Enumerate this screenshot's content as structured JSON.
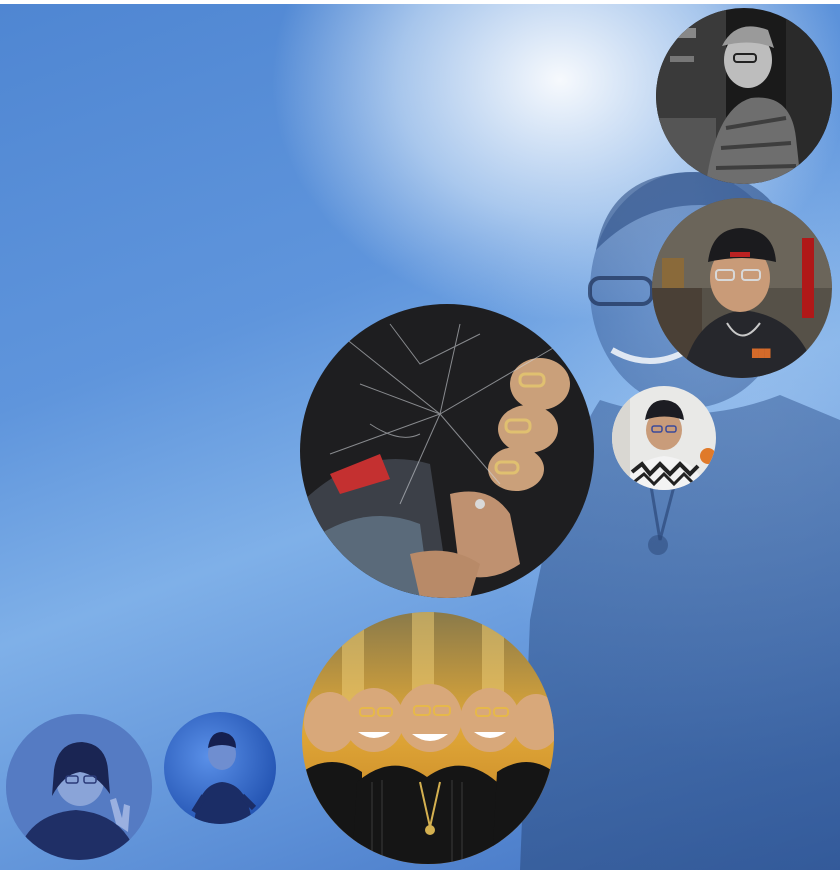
{
  "scene": {
    "background_color": "#5b8fd8",
    "highlight_color": "#ffffff",
    "accent_color": "#3f6fbf"
  },
  "photos": [
    {
      "id": "photo-bw-seated",
      "tone": "grayscale"
    },
    {
      "id": "photo-beanie-glasses",
      "tone": "color"
    },
    {
      "id": "photo-shattered-glass",
      "tone": "color"
    },
    {
      "id": "photo-small-portrait",
      "tone": "color"
    },
    {
      "id": "photo-golden-mirror",
      "tone": "color"
    },
    {
      "id": "photo-blue-hand-sign",
      "tone": "blue-tint"
    },
    {
      "id": "photo-blue-standing",
      "tone": "blue-tint"
    }
  ]
}
